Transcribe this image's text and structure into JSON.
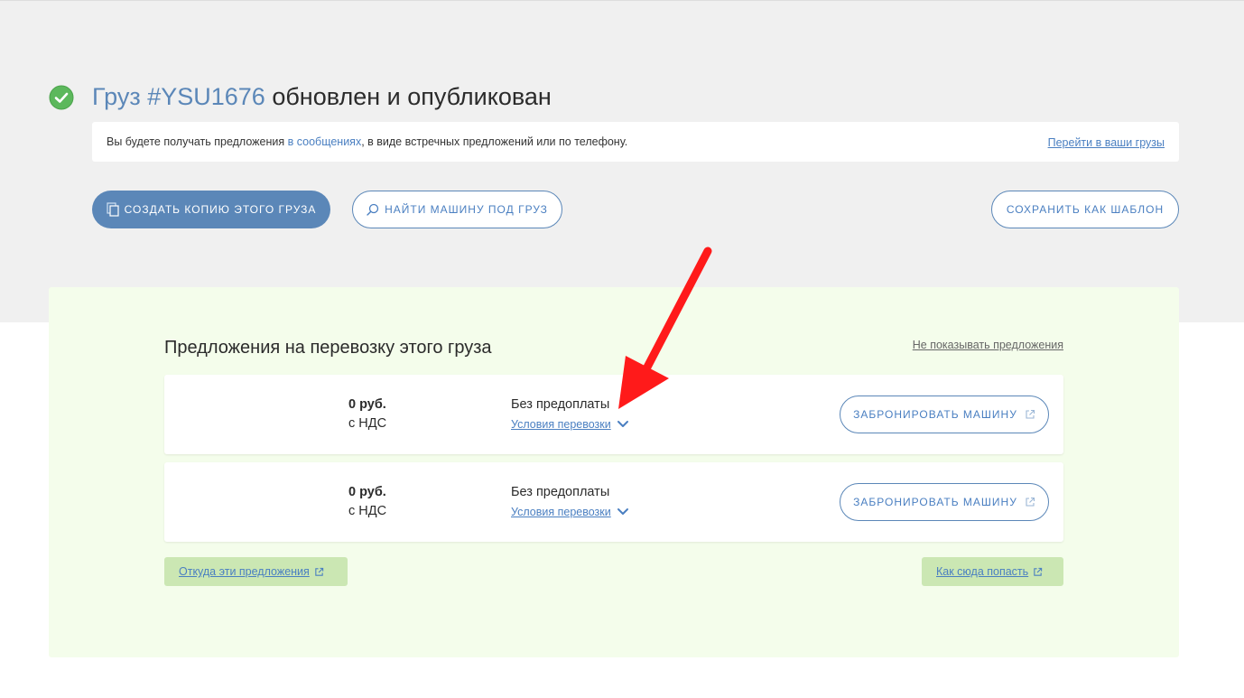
{
  "header": {
    "cargo_link": "Груз #YSU1676",
    "status_text": "обновлен и опубликован"
  },
  "info_bar": {
    "text_before": "Вы будете получать предложения ",
    "messages_link": "в сообщениях",
    "text_after": ", в виде встречных предложений или по телефону.",
    "goto_link": "Перейти в ваши грузы"
  },
  "actions": {
    "copy_label": "СОЗДАТЬ КОПИЮ ЭТОГО ГРУЗА",
    "find_label": "НАЙТИ МАШИНУ ПОД ГРУЗ",
    "save_label": "СОХРАНИТЬ КАК ШАБЛОН"
  },
  "offers": {
    "title": "Предложения на перевозку этого груза",
    "hide_link": "Не показывать предложения",
    "items": [
      {
        "price": "0 руб.",
        "vat": "с НДС",
        "payment": "Без предоплаты",
        "terms": "Условия перевозки",
        "book_label": "ЗАБРОНИРОВАТЬ МАШИНУ"
      },
      {
        "price": "0 руб.",
        "vat": "с НДС",
        "payment": "Без предоплаты",
        "terms": "Условия перевозки",
        "book_label": "ЗАБРОНИРОВАТЬ МАШИНУ"
      }
    ],
    "source_link": "Откуда эти предложения",
    "how_link": "Как сюда попасть"
  },
  "icons": {
    "success": "check-circle-icon",
    "copy": "copy-icon",
    "search": "search-icon",
    "chevron": "chevron-down-icon",
    "external": "external-link-icon",
    "annotation": "red-arrow"
  },
  "colors": {
    "accent": "#5b87b8",
    "link": "#4a7fc1",
    "success": "#5cb85c",
    "panel_bg": "#f4fdeb",
    "tag_bg": "#cbe7b3",
    "annotation_arrow": "#ff1a1a"
  }
}
